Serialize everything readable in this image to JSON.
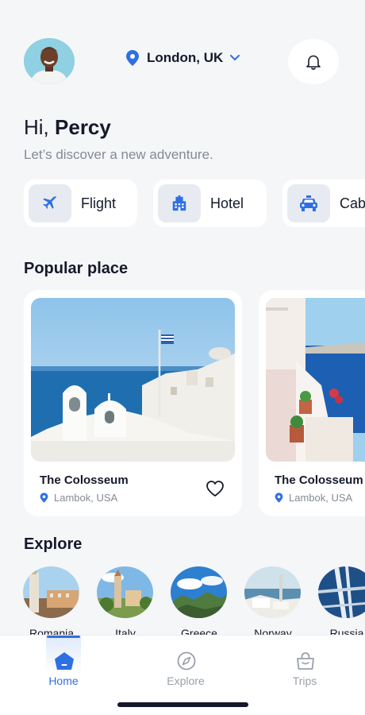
{
  "header": {
    "location": "London, UK",
    "icons": {
      "location": "location-pin-icon",
      "dropdown": "chevron-down-icon",
      "notifications": "bell-icon"
    }
  },
  "greeting": {
    "hi": "Hi,",
    "name": "Percy",
    "subtitle": "Let’s discover a new adventure."
  },
  "categories": [
    {
      "label": "Flight",
      "icon": "airplane-icon"
    },
    {
      "label": "Hotel",
      "icon": "hotel-building-icon"
    },
    {
      "label": "Cab",
      "icon": "taxi-icon"
    }
  ],
  "popular": {
    "title": "Popular place",
    "places": [
      {
        "name": "The Colosseum",
        "location": "Lambok, USA",
        "favorite": false
      },
      {
        "name": "The Colosseum",
        "location": "Lambok, USA",
        "favorite": false
      }
    ]
  },
  "explore": {
    "title": "Explore",
    "countries": [
      "Romania",
      "Italy",
      "Greece",
      "Norway",
      "Russia"
    ]
  },
  "bottom_nav": {
    "active": "Home",
    "items": [
      {
        "label": "Home",
        "icon": "home-icon"
      },
      {
        "label": "Explore",
        "icon": "compass-icon"
      },
      {
        "label": "Trips",
        "icon": "bag-icon"
      }
    ]
  },
  "colors": {
    "accent": "#2f6fe4",
    "background": "#f5f6f8",
    "text": "#15192b",
    "muted": "#858a96"
  }
}
